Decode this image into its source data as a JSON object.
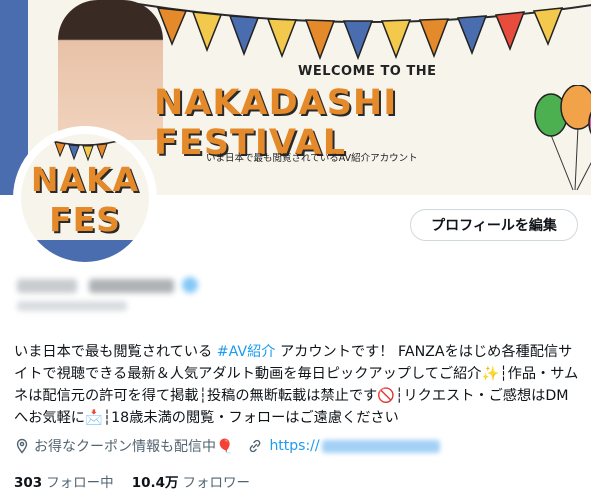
{
  "header": {
    "banner_welcome": "WELCOME TO THE",
    "banner_title": "NAKADASHI FESTIVAL",
    "banner_subtitle": "いま日本で最も閲覧されているAV紹介アカウント",
    "avatar_line1": "NAKA",
    "avatar_line2": "FES",
    "edit_profile_label": "プロフィールを編集"
  },
  "bio": {
    "text_before_tag": "いま日本で最も閲覧されている ",
    "hashtag": "#AV紹介",
    "text_after_tag": " アカウントです！ FANZAをはじめ各種配信サイトで視聴できる最新＆人気アダルト動画を毎日ピックアップしてご紹介✨┆作品・サムネは配信元の許可を得て掲載┆投稿の無断転載は禁止です🚫┆リクエスト・ご感想はDMへお気軽に📩┆18歳未満の閲覧・フォローはご遠慮ください"
  },
  "meta": {
    "location_text": "お得なクーポン情報も配信中🎈",
    "link_prefix": "https://"
  },
  "stats": {
    "following_count": "303",
    "following_label": "フォロー中",
    "followers_count": "10.4万",
    "followers_label": "フォロワー"
  },
  "colors": {
    "accent": "#1d9bf0",
    "banner_blue": "#4a6db0",
    "banner_orange": "#e58a2a"
  }
}
